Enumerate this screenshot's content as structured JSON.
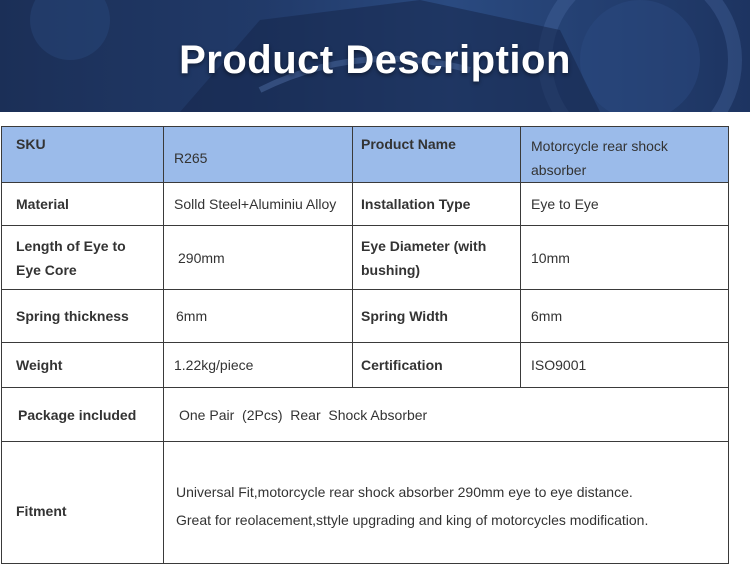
{
  "banner": {
    "title": "Product Description",
    "colors": {
      "background": "#213a69",
      "title": "#ffffff"
    }
  },
  "table": {
    "header_color": "#9bbbea",
    "border_color": "#3a3a3a",
    "rows": [
      {
        "label1": "SKU",
        "value1": "R265",
        "label2": "Product Name",
        "value2": "Motorcycle rear shock absorber"
      },
      {
        "label1": "Material",
        "value1": "Solld Steel+Aluminiu Alloy",
        "label2": "Installation Type",
        "value2": "Eye to Eye"
      },
      {
        "label1": "Length of Eye to Eye Core",
        "value1": "290mm",
        "label2": "Eye Diameter (with bushing)",
        "value2": "10mm"
      },
      {
        "label1": "Spring thickness",
        "value1": "6mm",
        "label2": "Spring Width",
        "value2": "6mm"
      },
      {
        "label1": "Weight",
        "value1": "1.22kg/piece",
        "label2": "Certification",
        "value2": "ISO9001"
      }
    ],
    "package": {
      "label": "Package included",
      "value": "One Pair  (2Pcs)  Rear  Shock Absorber"
    },
    "fitment": {
      "label": "Fitment",
      "lines": [
        "Universal Fit,motorcycle rear shock absorber 290mm eye to eye distance.",
        "Great  for reolacement,sttyle upgrading and king of motorcycles modification."
      ]
    }
  }
}
